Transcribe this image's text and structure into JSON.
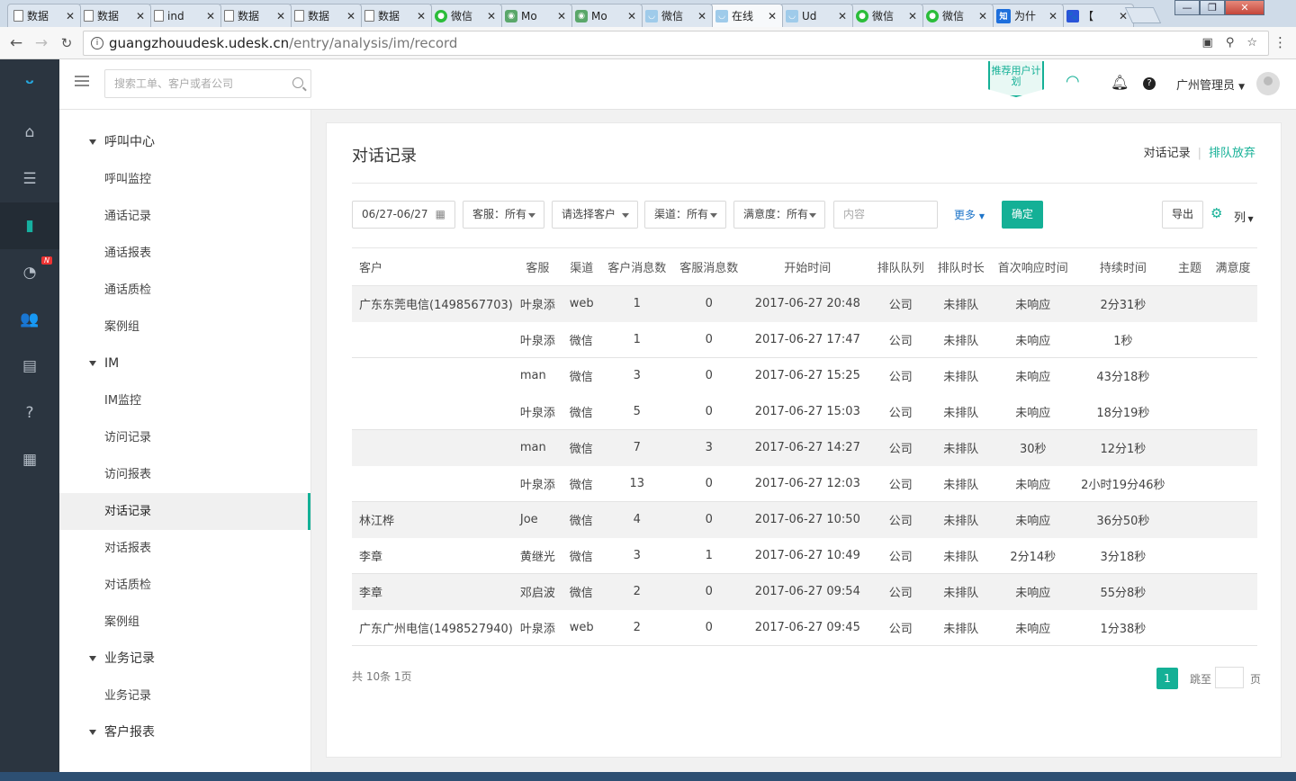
{
  "browser": {
    "tabs": [
      {
        "icon": "doc-icon",
        "title": "数据"
      },
      {
        "icon": "doc-icon",
        "title": "数据"
      },
      {
        "icon": "doc-icon",
        "title": "ind"
      },
      {
        "icon": "doc-icon",
        "title": "数据"
      },
      {
        "icon": "doc-icon",
        "title": "数据"
      },
      {
        "icon": "doc-icon",
        "title": "数据"
      },
      {
        "icon": "wechat-icon",
        "title": "微信"
      },
      {
        "icon": "moments-icon",
        "title": "Mo"
      },
      {
        "icon": "moments-icon",
        "title": "Mo"
      },
      {
        "icon": "udesk-icon",
        "title": "微信"
      },
      {
        "icon": "udesk-icon",
        "title": "在线"
      },
      {
        "icon": "udesk-icon",
        "title": "Ud"
      },
      {
        "icon": "wechat-icon",
        "title": "微信"
      },
      {
        "icon": "wechat-icon",
        "title": "微信"
      },
      {
        "icon": "zhihu-icon",
        "title": "为什"
      },
      {
        "icon": "baidu-icon",
        "title": "【"
      }
    ],
    "url_host": "guangzhouudesk.udesk.cn",
    "url_path": "/entry/analysis/im/record"
  },
  "topbar": {
    "search_placeholder": "搜索工单、客户或者公司",
    "promo_label": "推荐用户计划",
    "user_name": "广州管理员"
  },
  "sidebar": {
    "groups": [
      {
        "label": "呼叫中心",
        "items": [
          "呼叫监控",
          "通话记录",
          "通话报表",
          "通话质检",
          "案例组"
        ]
      },
      {
        "label": "IM",
        "items": [
          "IM监控",
          "访问记录",
          "访问报表",
          "对话记录",
          "对话报表",
          "对话质检",
          "案例组"
        ]
      },
      {
        "label": "业务记录",
        "items": [
          "业务记录"
        ]
      },
      {
        "label": "客户报表",
        "items": []
      }
    ],
    "active_item": "对话记录"
  },
  "page": {
    "title": "对话记录",
    "links": {
      "current": "对话记录",
      "other": "排队放弃"
    },
    "filters": {
      "date_range": "06/27-06/27",
      "agent": "客服：所有",
      "customer": "请选择客户",
      "channel": "渠道：所有",
      "satisfaction": "满意度：所有",
      "content_placeholder": "内容",
      "more_label": "更多",
      "confirm_label": "确定",
      "export_label": "导出",
      "columns_label": "列"
    },
    "table": {
      "headers": [
        "客户",
        "客服",
        "渠道",
        "客户消息数",
        "客服消息数",
        "开始时间",
        "排队队列",
        "排队时长",
        "首次响应时间",
        "持续时间",
        "主题",
        "满意度"
      ],
      "rows": [
        [
          "广东东莞电信(1498567703)",
          "叶泉添",
          "web",
          "1",
          "0",
          "2017-06-27 20:48",
          "公司",
          "未排队",
          "未响应",
          "2分31秒",
          "",
          ""
        ],
        [
          "",
          "叶泉添",
          "微信",
          "1",
          "0",
          "2017-06-27 17:47",
          "公司",
          "未排队",
          "未响应",
          "1秒",
          "",
          ""
        ],
        [
          "",
          "man",
          "微信",
          "3",
          "0",
          "2017-06-27 15:25",
          "公司",
          "未排队",
          "未响应",
          "43分18秒",
          "",
          ""
        ],
        [
          "",
          "叶泉添",
          "微信",
          "5",
          "0",
          "2017-06-27 15:03",
          "公司",
          "未排队",
          "未响应",
          "18分19秒",
          "",
          ""
        ],
        [
          "",
          "man",
          "微信",
          "7",
          "3",
          "2017-06-27 14:27",
          "公司",
          "未排队",
          "30秒",
          "12分1秒",
          "",
          ""
        ],
        [
          "",
          "叶泉添",
          "微信",
          "13",
          "0",
          "2017-06-27 12:03",
          "公司",
          "未排队",
          "未响应",
          "2小时19分46秒",
          "",
          ""
        ],
        [
          "林江桦",
          "Joe",
          "微信",
          "4",
          "0",
          "2017-06-27 10:50",
          "公司",
          "未排队",
          "未响应",
          "36分50秒",
          "",
          ""
        ],
        [
          "李章",
          "黄继光",
          "微信",
          "3",
          "1",
          "2017-06-27 10:49",
          "公司",
          "未排队",
          "2分14秒",
          "3分18秒",
          "",
          ""
        ],
        [
          "李章",
          "邓启波",
          "微信",
          "2",
          "0",
          "2017-06-27 09:54",
          "公司",
          "未排队",
          "未响应",
          "55分8秒",
          "",
          ""
        ],
        [
          "广东广州电信(1498527940)",
          "叶泉添",
          "web",
          "2",
          "0",
          "2017-06-27 09:45",
          "公司",
          "未排队",
          "未响应",
          "1分38秒",
          "",
          ""
        ]
      ]
    },
    "footer": {
      "summary": "共 10条 1页",
      "current_page": "1",
      "jump_label": "跳至",
      "page_label": "页"
    }
  },
  "colors": {
    "accent": "#14b096",
    "rail_bg": "#2b3540",
    "link": "#1d74c9"
  }
}
